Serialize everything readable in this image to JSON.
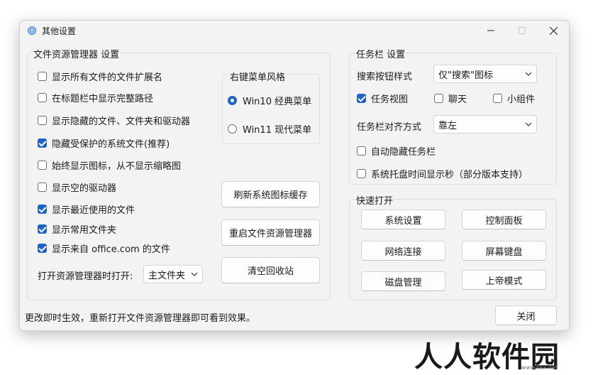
{
  "window": {
    "title": "其他设置"
  },
  "explorer": {
    "title": "文件资源管理器 设置",
    "options": [
      {
        "label": "显示所有文件的文件扩展名",
        "checked": false
      },
      {
        "label": "在标题栏中显示完整路径",
        "checked": false
      },
      {
        "label": "显示隐藏的文件、文件夹和驱动器",
        "checked": false
      },
      {
        "label": "隐藏受保护的系统文件(推荐)",
        "checked": true
      },
      {
        "label": "始终显示图标，从不显示缩略图",
        "checked": false
      },
      {
        "label": "显示空的驱动器",
        "checked": false
      },
      {
        "label": "显示最近使用的文件",
        "checked": true
      },
      {
        "label": "显示常用文件夹",
        "checked": true
      },
      {
        "label": "显示来自 office.com 的文件",
        "checked": true
      }
    ],
    "open_label": "打开资源管理器时打开:",
    "open_value": "主文件夹",
    "menu_style": {
      "title": "右键菜单风格",
      "options": [
        {
          "label": "Win10 经典菜单",
          "selected": true
        },
        {
          "label": "Win11 现代菜单",
          "selected": false
        }
      ]
    },
    "buttons": {
      "refresh_icon_cache": "刷新系统图标缓存",
      "restart_explorer": "重启文件资源管理器",
      "empty_recycle_bin": "清空回收站"
    }
  },
  "taskbar": {
    "title": "任务栏 设置",
    "search_label": "搜索按钮样式",
    "search_value": "仅\"搜索\"图标",
    "task_view": {
      "label": "任务视图",
      "checked": true
    },
    "chat": {
      "label": "聊天",
      "checked": false
    },
    "widgets": {
      "label": "小组件",
      "checked": false
    },
    "align_label": "任务栏对齐方式",
    "align_value": "靠左",
    "auto_hide": {
      "label": "自动隐藏任务栏",
      "checked": false
    },
    "show_seconds": {
      "label": "系统托盘时间显示秒（部分版本支持）",
      "checked": false
    }
  },
  "quick_open": {
    "title": "快速打开",
    "buttons": {
      "system_settings": "系统设置",
      "control_panel": "控制面板",
      "network": "网络连接",
      "osk": "屏幕键盘",
      "disk_mgmt": "磁盘管理",
      "god_mode": "上帝模式"
    }
  },
  "footer": {
    "status": "更改即时生效，重新打开文件资源管理器即可看到效果。",
    "close_label": "关闭"
  },
  "watermark": {
    "text": "人人软件园",
    "url": "www.kkx.net"
  },
  "colors": {
    "accent": "#1f62c5",
    "window_bg": "#f3f3f3"
  }
}
